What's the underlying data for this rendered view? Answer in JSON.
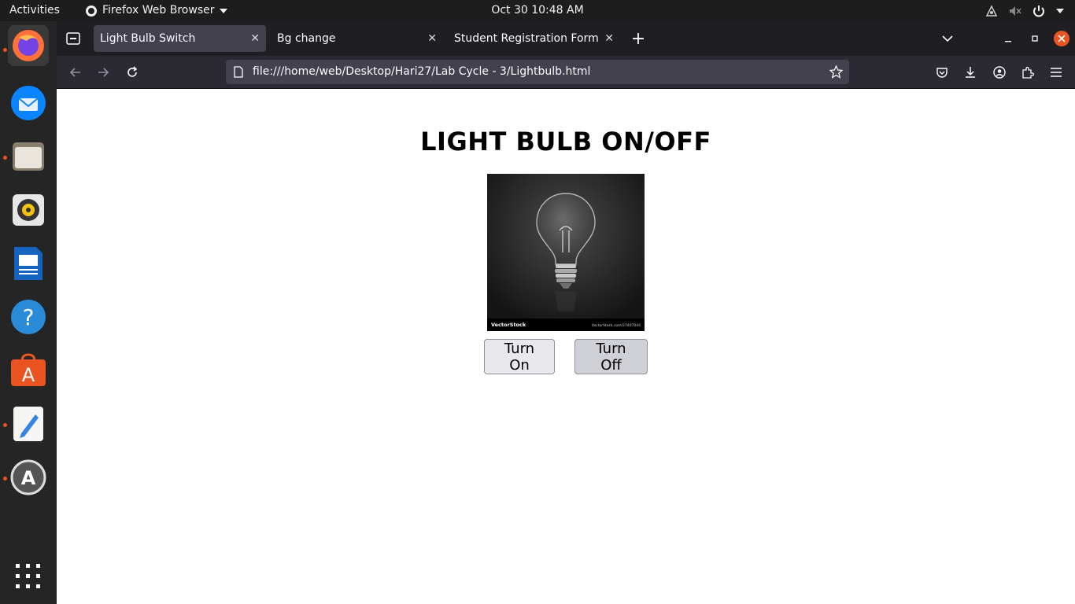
{
  "system": {
    "activities": "Activities",
    "app_name": "Firefox Web Browser",
    "clock": "Oct 30  10:48 AM"
  },
  "dock": {
    "items": [
      "firefox-icon",
      "thunderbird-icon",
      "files-icon",
      "rhythmbox-icon",
      "writer-icon",
      "help-icon",
      "app-center-icon",
      "text-editor-icon",
      "update-icon"
    ],
    "show_apps": "show-apps-icon"
  },
  "browser": {
    "tabs": [
      {
        "label": "Light Bulb Switch",
        "active": true
      },
      {
        "label": "Bg change",
        "active": false
      },
      {
        "label": "Student Registration Form",
        "active": false
      }
    ],
    "new_tab": "+",
    "url": "file:///home/web/Desktop/Hari27/Lab Cycle - 3/Lightbulb.html"
  },
  "page": {
    "title": "LIGHT BULB ON/OFF",
    "image_watermark_left": "VectorStock",
    "image_watermark_right": "VectorStock.com/27407044",
    "btn_on": "Turn On",
    "btn_off": "Turn Off"
  },
  "colors": {
    "accent": "#e95420",
    "topbar": "#1d1d1d",
    "tabstrip": "#1f1e23",
    "navbar": "#2b2a33"
  }
}
